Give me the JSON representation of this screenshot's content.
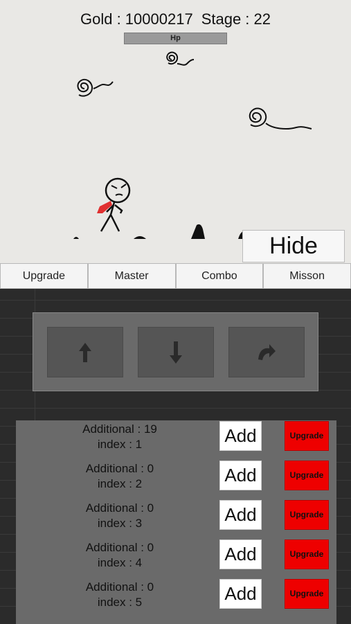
{
  "hud": {
    "gold_label": "Gold : 10000217",
    "stage_label": "Stage : 22",
    "hp_label": "Hp"
  },
  "hide_button": "Hide",
  "tabs": [
    "Upgrade",
    "Master",
    "Combo",
    "Misson"
  ],
  "combo_buttons": [
    {
      "icon": "arrow-up-icon"
    },
    {
      "icon": "arrow-down-icon"
    },
    {
      "icon": "arrow-rotate-icon"
    }
  ],
  "rows": [
    {
      "additional": "Additional : 19",
      "index": "index : 1",
      "add": "Add",
      "upgrade": "Upgrade"
    },
    {
      "additional": "Additional : 0",
      "index": "index : 2",
      "add": "Add",
      "upgrade": "Upgrade"
    },
    {
      "additional": "Additional : 0",
      "index": "index : 3",
      "add": "Add",
      "upgrade": "Upgrade"
    },
    {
      "additional": "Additional : 0",
      "index": "index : 4",
      "add": "Add",
      "upgrade": "Upgrade"
    },
    {
      "additional": "Additional : 0",
      "index": "index : 5",
      "add": "Add",
      "upgrade": "Upgrade"
    }
  ],
  "colors": {
    "upgrade_button": "#ee0000",
    "scarf": "#e03030",
    "paper": "#e9e8e5"
  }
}
